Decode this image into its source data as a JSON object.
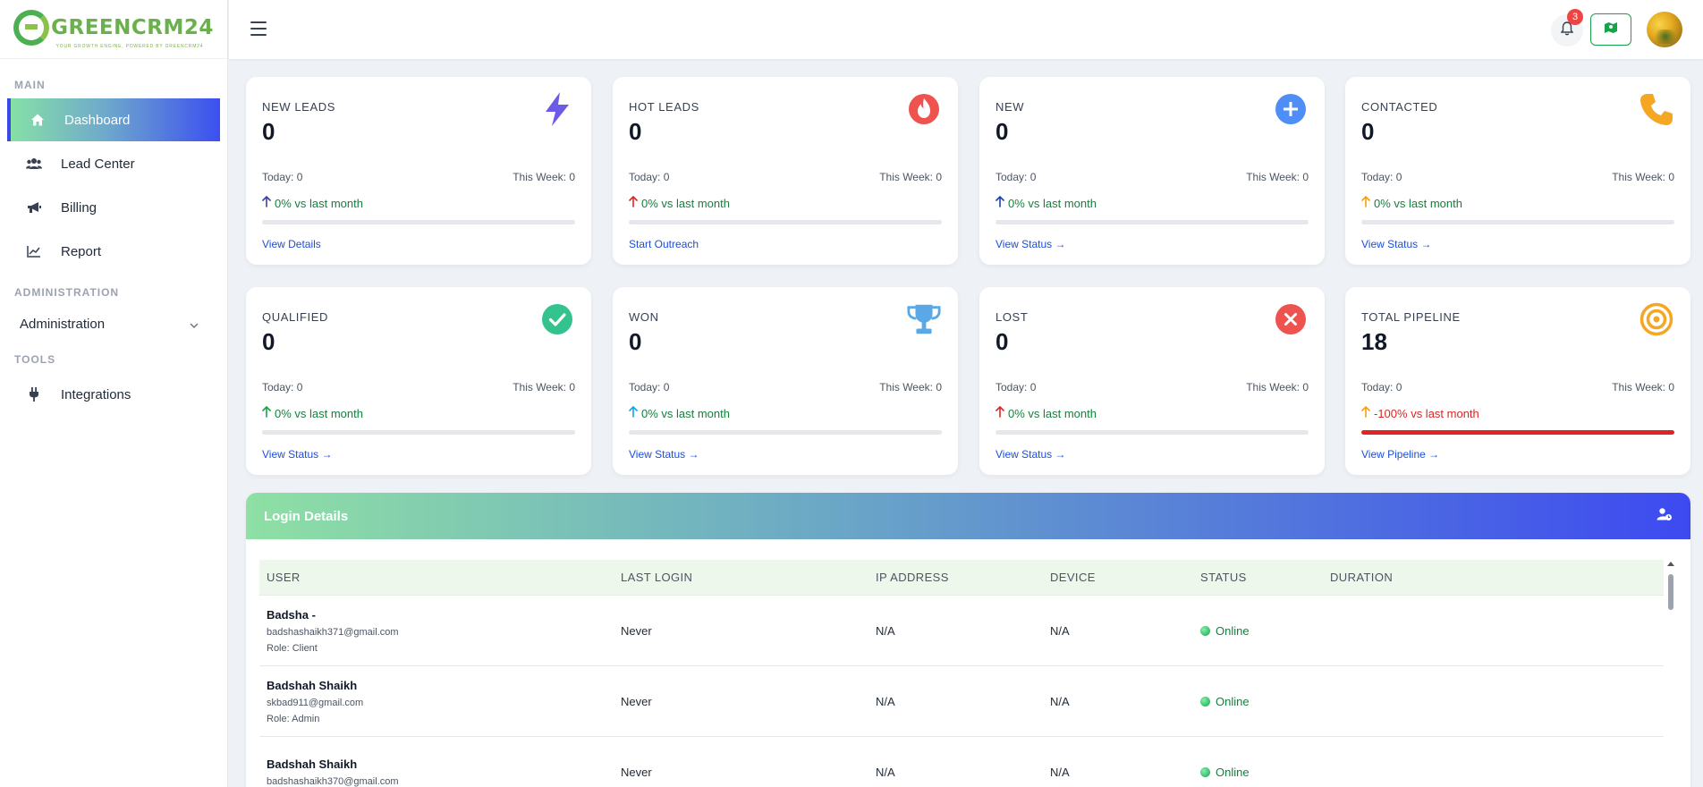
{
  "brand": {
    "name": "GREENCRM24",
    "tagline": "YOUR GROWTH ENGINE, POWERED BY GREENCRM24"
  },
  "sidebar": {
    "sections": {
      "main": "MAIN",
      "administration": "ADMINISTRATION",
      "tools": "TOOLS"
    },
    "items": [
      {
        "label": "Dashboard",
        "icon": "home-icon",
        "active": true
      },
      {
        "label": "Lead Center",
        "icon": "users-icon"
      },
      {
        "label": "Billing",
        "icon": "megaphone-icon"
      },
      {
        "label": "Report",
        "icon": "chart-line-icon"
      }
    ],
    "administration_label": "Administration",
    "tools_items": [
      {
        "label": "Integrations",
        "icon": "plug-icon"
      }
    ]
  },
  "header": {
    "notification_count": "3"
  },
  "cards": [
    {
      "title": "NEW LEADS",
      "value": "0",
      "today": "Today: 0",
      "week": "This Week: 0",
      "change": "0% vs last month",
      "link": "View Details",
      "icon": "bolt-icon",
      "icon_color": "#6d5be8",
      "arrow_color": "#3b3f9f",
      "progress": 0
    },
    {
      "title": "HOT LEADS",
      "value": "0",
      "today": "Today: 0",
      "week": "This Week: 0",
      "change": "0% vs last month",
      "link": "Start Outreach",
      "icon": "fire-icon",
      "icon_color": "#ef5350",
      "arrow_color": "#dc2626",
      "progress": 0
    },
    {
      "title": "NEW",
      "value": "0",
      "today": "Today: 0",
      "week": "This Week: 0",
      "change": "0% vs last month",
      "link": "View Status →",
      "icon": "plus-circle-icon",
      "icon_color": "#4f8ef7",
      "arrow_color": "#1e40af",
      "progress": 0
    },
    {
      "title": "CONTACTED",
      "value": "0",
      "today": "Today: 0",
      "week": "This Week: 0",
      "change": "0% vs last month",
      "link": "View Status →",
      "icon": "phone-icon",
      "icon_color": "#f5a623",
      "arrow_color": "#f59e0b",
      "progress": 0
    },
    {
      "title": "QUALIFIED",
      "value": "0",
      "today": "Today: 0",
      "week": "This Week: 0",
      "change": "0% vs last month",
      "link": "View Status →",
      "icon": "check-circle-icon",
      "icon_color": "#34c38f",
      "arrow_color": "#16a34a",
      "progress": 0
    },
    {
      "title": "WON",
      "value": "0",
      "today": "Today: 0",
      "week": "This Week: 0",
      "change": "0% vs last month",
      "link": "View Status →",
      "icon": "trophy-icon",
      "icon_color": "#5aa9e6",
      "arrow_color": "#0ea5e9",
      "progress": 0
    },
    {
      "title": "LOST",
      "value": "0",
      "today": "Today: 0",
      "week": "This Week: 0",
      "change": "0% vs last month",
      "link": "View Status →",
      "icon": "x-circle-icon",
      "icon_color": "#ef5350",
      "arrow_color": "#dc2626",
      "progress": 0
    },
    {
      "title": "TOTAL PIPELINE",
      "value": "18",
      "today": "Today: 0",
      "week": "This Week: 0",
      "change": "-100% vs last month",
      "link": "View Pipeline →",
      "icon": "target-icon",
      "icon_color": "#f5a623",
      "arrow_color": "#f59e0b",
      "progress": 100,
      "negative": true
    }
  ],
  "login_panel": {
    "title": "Login Details",
    "columns": [
      "USER",
      "LAST LOGIN",
      "IP ADDRESS",
      "DEVICE",
      "STATUS",
      "DURATION"
    ],
    "rows": [
      {
        "name": "Badsha -",
        "email": "badshashaikh371@gmail.com",
        "role": "Role: Client",
        "last_login": "Never",
        "ip": "N/A",
        "device": "N/A",
        "status": "Online",
        "duration": ""
      },
      {
        "name": "Badshah Shaikh",
        "email": "skbad911@gmail.com",
        "role": "Role: Admin",
        "last_login": "Never",
        "ip": "N/A",
        "device": "N/A",
        "status": "Online",
        "duration": ""
      },
      {
        "name": "Badshah Shaikh",
        "email": "badshashaikh370@gmail.com",
        "role": "",
        "last_login": "Never",
        "ip": "N/A",
        "device": "N/A",
        "status": "Online",
        "duration": ""
      }
    ]
  }
}
